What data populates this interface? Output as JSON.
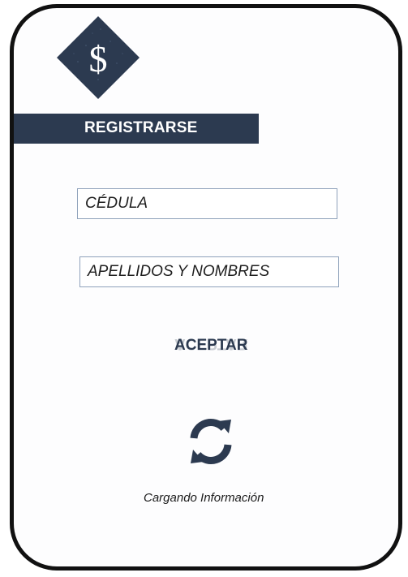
{
  "header": {
    "title": "REGISTRARSE"
  },
  "logo": {
    "symbol": "$",
    "icon": "dollar-diamond-icon"
  },
  "form": {
    "cedula_placeholder": "CÉDULA",
    "nombres_placeholder": "APELLIDOS Y NOMBRES"
  },
  "actions": {
    "accept_label": "ACEPTAR"
  },
  "status": {
    "loading_text": "Cargando Información",
    "icon": "refresh-icon"
  },
  "colors": {
    "brand": "#2c3a50",
    "field_border": "#8fa2bb"
  }
}
